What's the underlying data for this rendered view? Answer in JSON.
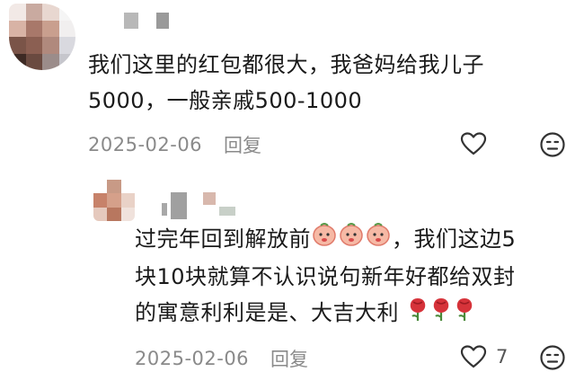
{
  "comment": {
    "text_line1": "我们这里的红包都很大，我爸妈给我儿子",
    "text_line2": "5000，一般亲戚500-1000",
    "date": "2025-02-06",
    "reply_label": "回复"
  },
  "reply": {
    "text_line1_a": "过完年回到解放前",
    "text_line1_b": "，我们这边5",
    "text_line2": "块10块就算不认识说句新年好都给双封",
    "text_line3": "的寓意利利是是、大吉大利",
    "date": "2025-02-06",
    "reply_label": "回复",
    "like_count": "7"
  },
  "icons": {
    "like": "heart-outline-icon",
    "dislike": "meh-face-icon",
    "emoji_peach": "peach-face-emoji",
    "emoji_rose": "rose-emoji"
  },
  "colors": {
    "text": "#1a1a1a",
    "meta": "#8a8a8a",
    "rose": "#d6333a",
    "peach": "#f6b9a5"
  }
}
